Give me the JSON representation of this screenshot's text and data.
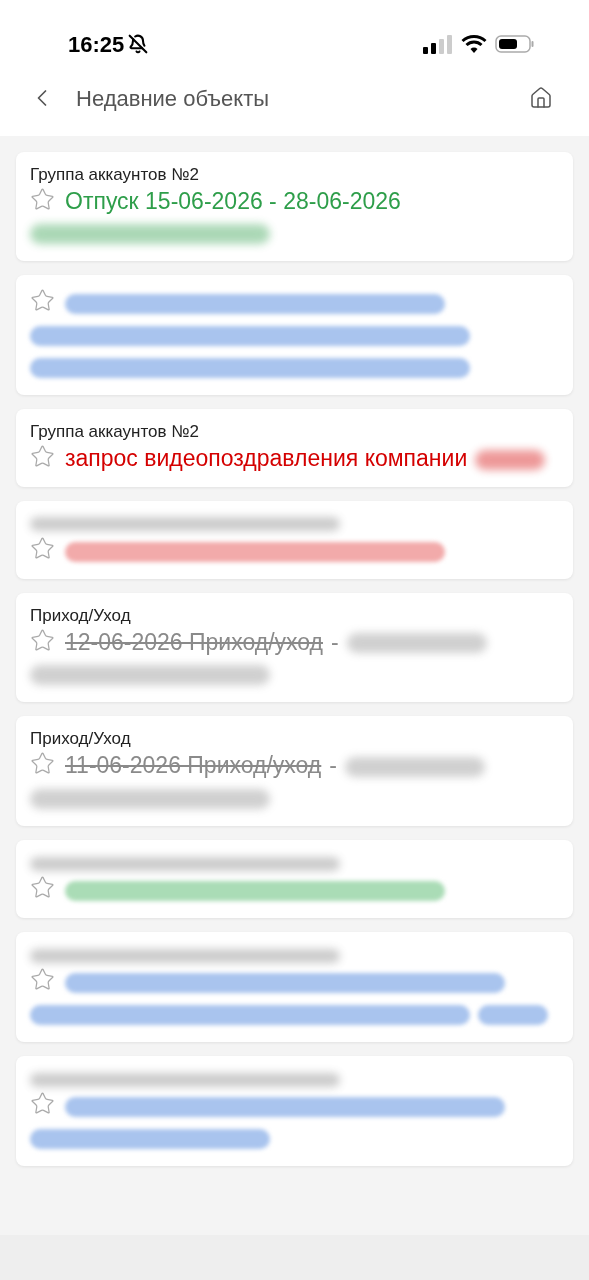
{
  "status_bar": {
    "time": "16:25"
  },
  "nav": {
    "title": "Недавние объекты"
  },
  "cards": [
    {
      "header": {
        "kind": "text",
        "text": "Группа аккаунтов №2"
      },
      "title": "Отпуск 15-06-2026 - 28-06-2026",
      "color": "#2e9e4a",
      "blurred": [
        {
          "kind": "medium"
        }
      ]
    },
    {
      "color": "#a9c4ee",
      "blurred": [
        {
          "kind": "long"
        },
        {
          "kind": "full"
        },
        {
          "kind": "full"
        }
      ]
    },
    {
      "header": {
        "kind": "text",
        "text": "Группа аккаунтов №2"
      },
      "title": "запрос видеопоздравления компании",
      "color": "#d40000",
      "blurred": [
        {
          "kind": "tiny"
        }
      ]
    },
    {
      "header": {
        "kind": "blurred"
      },
      "color": "#f2aaaa",
      "blurred": [
        {
          "kind": "long"
        }
      ]
    },
    {
      "header": {
        "kind": "text",
        "text": "Приход/Уход"
      },
      "title": "12-06-2026 Приход/уход",
      "struck": true,
      "separator": "-",
      "color": "#8a8a8a",
      "blurred": [
        {
          "kind": "short"
        },
        {
          "kind": "medium"
        }
      ]
    },
    {
      "header": {
        "kind": "text",
        "text": "Приход/Уход"
      },
      "title": "11-06-2026 Приход/уход",
      "struck": true,
      "separator": "-",
      "color": "#8a8a8a",
      "blurred": [
        {
          "kind": "short"
        },
        {
          "kind": "medium"
        }
      ]
    },
    {
      "header": {
        "kind": "blurred"
      },
      "color": "#aadcb6",
      "blurred": [
        {
          "kind": "long"
        }
      ]
    },
    {
      "header": {
        "kind": "blurred"
      },
      "color": "#a9c4ee",
      "blurred": [
        {
          "kind": "full"
        },
        {
          "kind": "full"
        },
        {
          "kind": "tiny"
        }
      ]
    },
    {
      "header": {
        "kind": "blurred"
      },
      "color": "#a9c4ee",
      "blurred": [
        {
          "kind": "full"
        },
        {
          "kind": "medium"
        }
      ]
    }
  ]
}
